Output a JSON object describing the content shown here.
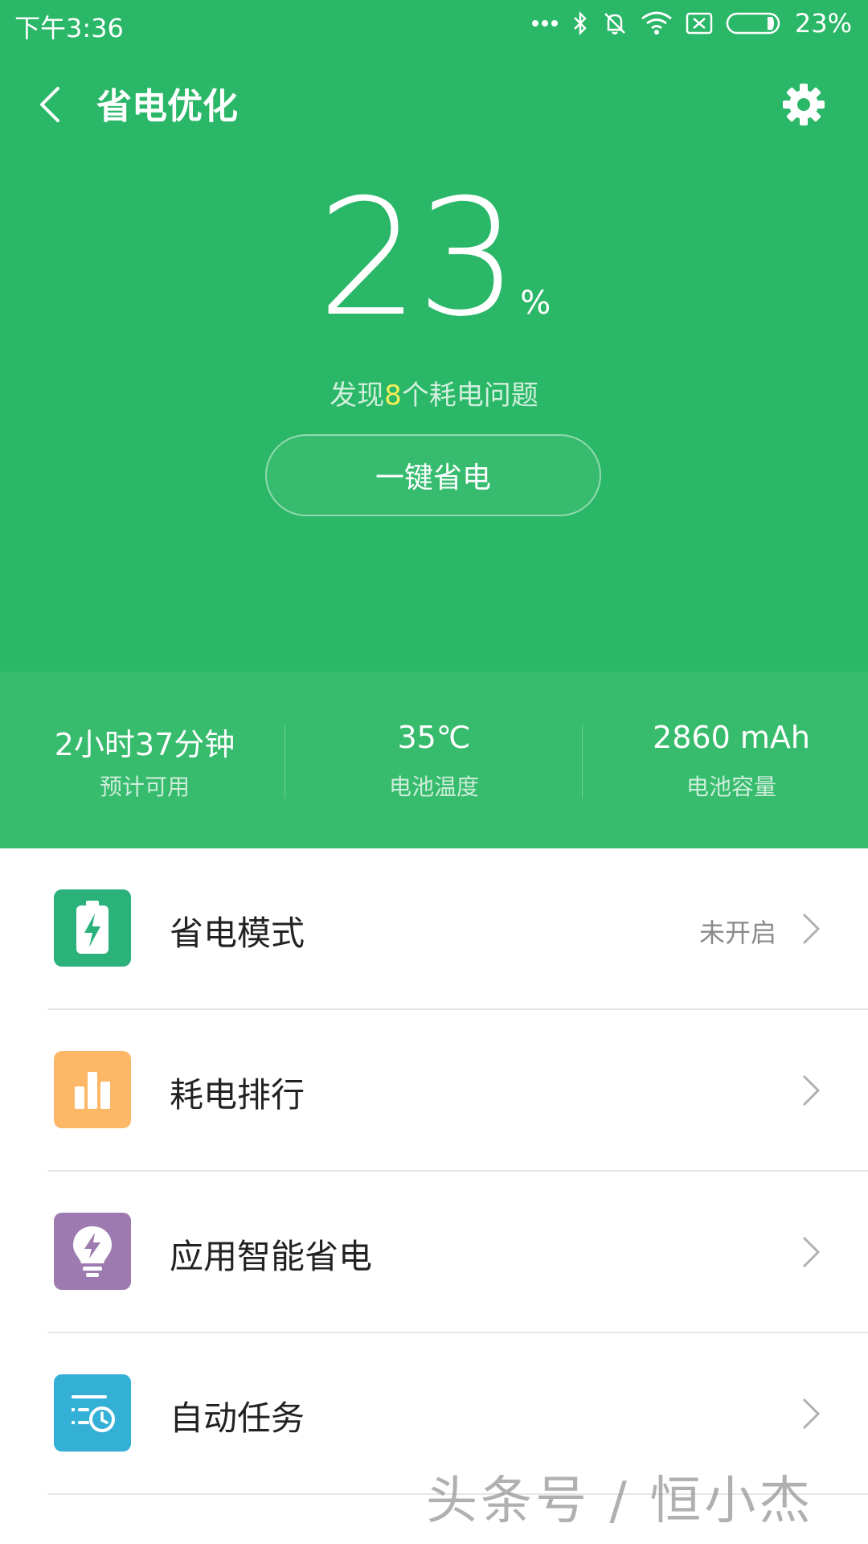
{
  "status_bar": {
    "time": "下午3:36",
    "battery_percent": "23%",
    "icons": [
      "more-dots-icon",
      "bluetooth-icon",
      "mute-bell-icon",
      "wifi-icon",
      "sim-off-icon",
      "battery-icon"
    ]
  },
  "header": {
    "title": "省电优化",
    "back_icon": "back-arrow-icon",
    "settings_icon": "gear-icon"
  },
  "battery": {
    "level": "23",
    "unit": "%",
    "issues_prefix": "发现",
    "issues_count": "8",
    "issues_suffix": "个耗电问题",
    "action_label": "一键省电"
  },
  "stats": [
    {
      "value": "2小时37分钟",
      "label": "预计可用"
    },
    {
      "value": "35℃",
      "label": "电池温度"
    },
    {
      "value": "2860 mAh",
      "label": "电池容量"
    }
  ],
  "menu": [
    {
      "label": "省电模式",
      "status": "未开启",
      "icon": "battery-bolt-icon",
      "color": "#2bb27a"
    },
    {
      "label": "耗电排行",
      "status": "",
      "icon": "bar-chart-icon",
      "color": "#fdb867"
    },
    {
      "label": "应用智能省电",
      "status": "",
      "icon": "lightbulb-bolt-icon",
      "color": "#9d7bb0"
    },
    {
      "label": "自动任务",
      "status": "",
      "icon": "task-clock-icon",
      "color": "#34b0d6"
    }
  ],
  "watermark": "头条号 / 恒小杰",
  "colors": {
    "primary_green": "#2ab767",
    "stats_green": "#37bb6d",
    "issue_highlight": "#f4ee5a"
  }
}
